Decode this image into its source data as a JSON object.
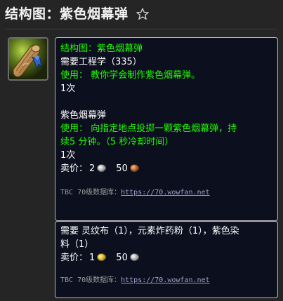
{
  "header": {
    "title": "结构图：紫色烟幕弹",
    "favorite_icon": "star-outline-icon"
  },
  "item_icon": "rolled-blueprint-icon",
  "recipe_tooltip": {
    "name": "结构图：紫色烟幕弹",
    "requires": "需要工程学（335）",
    "use_text": "使用：  教你学会制作紫色烟幕弹。",
    "charges": "1次",
    "product": {
      "name": "紫色烟幕弹",
      "use_line1": "使用：  向指定地点投掷一颗紫色烟幕弹，持",
      "use_line2": "续5 分钟。（5 秒冷却时间）",
      "charges": "1次",
      "sell_label": "卖价：",
      "sell_silver": "2",
      "sell_copper": "50"
    },
    "db_label": "TBC 70级数据库：",
    "db_link": "https://70.wowfan.net"
  },
  "reagents_tooltip": {
    "requires_line1": "需要  灵纹布（1），元素炸药粉（1），紫色染",
    "requires_line2": "料（1）",
    "sell_label": "卖价：",
    "sell_gold": "1",
    "sell_silver": "50",
    "db_label": "TBC 70级数据库：",
    "db_link": "https://70.wowfan.net"
  },
  "colors": {
    "spell_green": "#1eff00",
    "tooltip_bg": "#0c0f1e",
    "tooltip_border": "#b9b9b9",
    "page_bg": "#252525"
  }
}
